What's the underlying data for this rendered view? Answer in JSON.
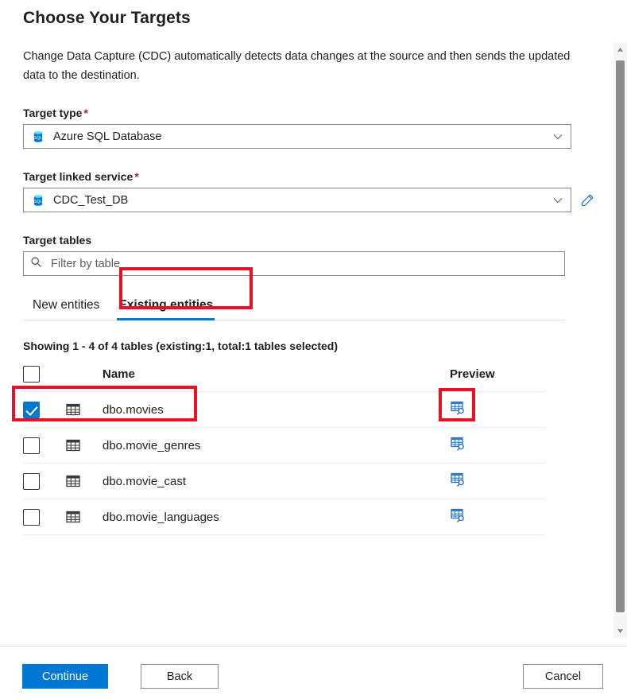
{
  "header": {
    "title": "Choose Your Targets",
    "description": "Change Data Capture (CDC) automatically detects data changes at the source and then sends the updated data to the destination."
  },
  "fields": {
    "target_type": {
      "label": "Target type",
      "required_marker": "*",
      "value": "Azure SQL Database",
      "icon": "azure-sql-database-icon",
      "chevron": "chevron-down-icon"
    },
    "target_linked_service": {
      "label": "Target linked service",
      "required_marker": "*",
      "value": "CDC_Test_DB",
      "icon": "azure-sql-database-icon",
      "chevron": "chevron-down-icon",
      "edit_icon": "pencil-edit-icon"
    },
    "target_tables": {
      "label": "Target tables",
      "search_placeholder": "Filter by table",
      "search_value": "",
      "search_icon": "search-icon"
    }
  },
  "tabs": [
    {
      "label": "New entities",
      "active": false
    },
    {
      "label": "Existing entities",
      "active": true
    }
  ],
  "showing_text": "Showing 1 - 4 of 4 tables (existing:1, total:1 tables selected)",
  "table": {
    "columns": [
      "",
      "",
      "Name",
      "Preview"
    ],
    "header_checkbox_checked": false,
    "rows": [
      {
        "checked": true,
        "icon": "table-grid-icon",
        "name": "dbo.movies",
        "preview_icon": "table-preview-icon"
      },
      {
        "checked": false,
        "icon": "table-grid-icon",
        "name": "dbo.movie_genres",
        "preview_icon": "table-preview-icon"
      },
      {
        "checked": false,
        "icon": "table-grid-icon",
        "name": "dbo.movie_cast",
        "preview_icon": "table-preview-icon"
      },
      {
        "checked": false,
        "icon": "table-grid-icon",
        "name": "dbo.movie_languages",
        "preview_icon": "table-preview-icon"
      }
    ]
  },
  "scrollbar": {
    "up_arrow_icon": "scroll-up-arrow-icon",
    "down_arrow_icon": "scroll-down-arrow-icon"
  },
  "footer": {
    "continue_label": "Continue",
    "back_label": "Back",
    "cancel_label": "Cancel"
  },
  "colors": {
    "accent": "#0078d4",
    "required": "#a4262c",
    "annotation": "#e81123",
    "border": "#8a8886",
    "row_divider": "#edebe9"
  },
  "annotations": [
    {
      "name": "existing-entities-tab-highlight"
    },
    {
      "name": "selected-row-highlight"
    },
    {
      "name": "preview-icon-highlight"
    }
  ]
}
